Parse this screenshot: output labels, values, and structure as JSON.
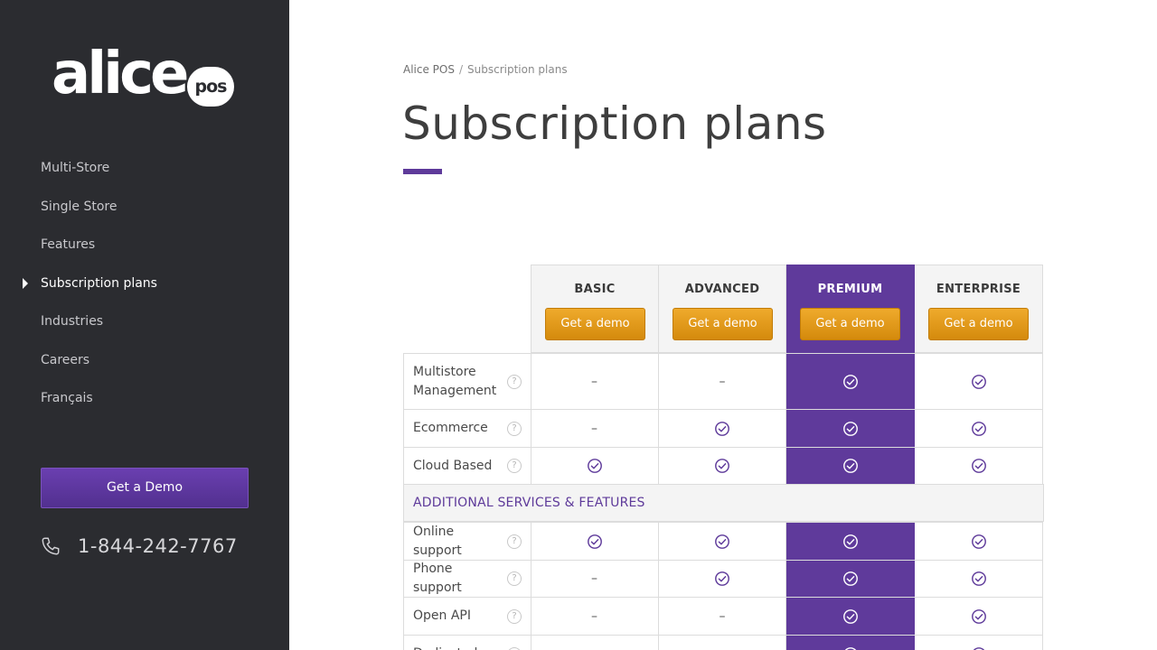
{
  "logo": {
    "word": "alice",
    "badge": "pos"
  },
  "sidebar": {
    "items": [
      {
        "label": "Multi-Store",
        "active": false
      },
      {
        "label": "Single Store",
        "active": false
      },
      {
        "label": "Features",
        "active": false
      },
      {
        "label": "Subscription plans",
        "active": true
      },
      {
        "label": "Industries",
        "active": false
      },
      {
        "label": "Careers",
        "active": false
      },
      {
        "label": "Français",
        "active": false
      }
    ],
    "demo_label": "Get a Demo",
    "phone": "1-844-242-7767"
  },
  "breadcrumb": {
    "root": "Alice POS",
    "separator": "/",
    "current": "Subscription plans"
  },
  "page": {
    "title": "Subscription plans"
  },
  "colors": {
    "sidebar_bg": "#2b2c30",
    "accent": "#5f3a9b",
    "button": "#e39a1c"
  },
  "plans": [
    {
      "name": "BASIC",
      "button": "Get a demo"
    },
    {
      "name": "ADVANCED",
      "button": "Get a demo"
    },
    {
      "name": "PREMIUM",
      "button": "Get a demo",
      "highlighted": true
    },
    {
      "name": "ENTERPRISE",
      "button": "Get a demo"
    }
  ],
  "table": {
    "help_glyph": "?",
    "dash_glyph": "–",
    "rows": [
      {
        "type": "feature",
        "label": "Multistore Management",
        "values": [
          false,
          false,
          true,
          true
        ]
      },
      {
        "type": "feature",
        "label": "Ecommerce",
        "values": [
          false,
          true,
          true,
          true
        ]
      },
      {
        "type": "feature",
        "label": "Cloud Based",
        "values": [
          true,
          true,
          true,
          true
        ]
      },
      {
        "type": "section",
        "label": "ADDITIONAL SERVICES & FEATURES"
      },
      {
        "type": "feature",
        "label": "Online support",
        "values": [
          true,
          true,
          true,
          true
        ]
      },
      {
        "type": "feature",
        "label": "Phone support",
        "values": [
          false,
          true,
          true,
          true
        ]
      },
      {
        "type": "feature",
        "label": "Open API",
        "values": [
          false,
          false,
          true,
          true
        ]
      },
      {
        "type": "feature",
        "label": "Dedicated",
        "values": [
          false,
          false,
          true,
          true
        ]
      }
    ]
  }
}
